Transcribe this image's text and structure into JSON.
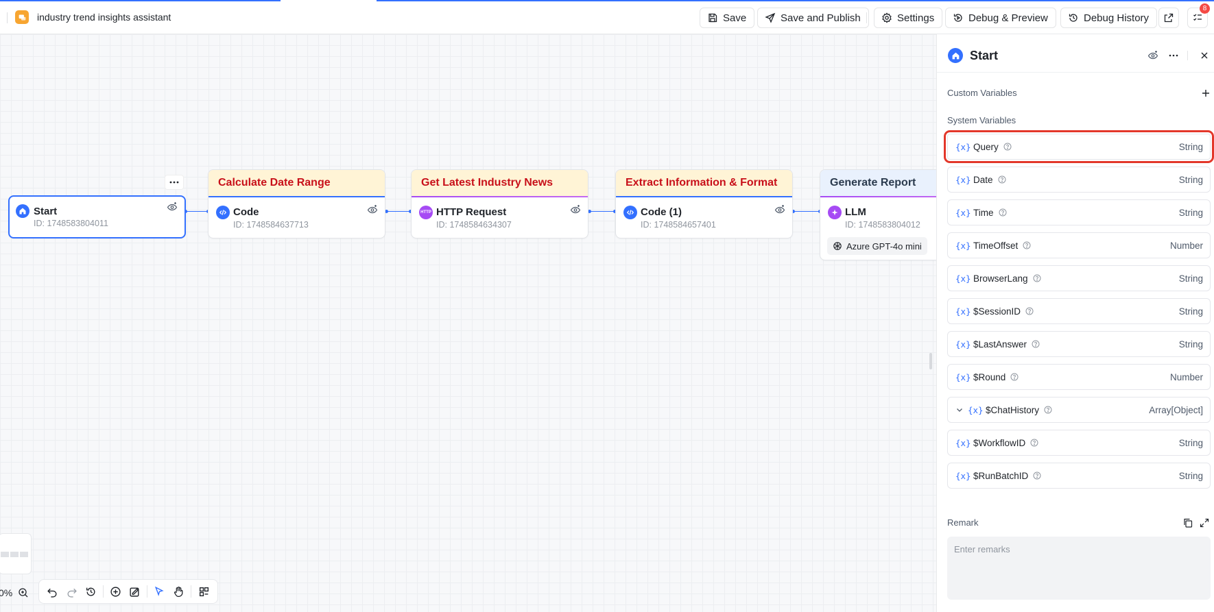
{
  "app": {
    "title": "industry trend insights assistant",
    "accent": "#3370ff"
  },
  "toolbar": {
    "save": "Save",
    "save_publish": "Save and Publish",
    "settings": "Settings",
    "debug_preview": "Debug & Preview",
    "debug_history": "Debug History",
    "notification_count": "8"
  },
  "canvas": {
    "zoom": "0%",
    "nodes": [
      {
        "name": "Start",
        "id": "ID: 1748583804011"
      },
      {
        "header": "Calculate Date Range",
        "name": "Code",
        "id": "ID: 1748584637713"
      },
      {
        "header": "Get Latest Industry News",
        "name": "HTTP Request",
        "id": "ID: 1748584634307",
        "icon_text": "HTTP"
      },
      {
        "header": "Extract Information & Format",
        "name": "Code (1)",
        "id": "ID: 1748584657401"
      },
      {
        "header": "Generate Report",
        "name": "LLM",
        "id": "ID: 1748583804012",
        "model": "Azure GPT-4o mini"
      }
    ]
  },
  "panel": {
    "title": "Start",
    "custom_variables_label": "Custom Variables",
    "system_variables_label": "System Variables",
    "variables": [
      {
        "name": "Query",
        "type": "String"
      },
      {
        "name": "Date",
        "type": "String"
      },
      {
        "name": "Time",
        "type": "String"
      },
      {
        "name": "TimeOffset",
        "type": "Number"
      },
      {
        "name": "BrowserLang",
        "type": "String"
      },
      {
        "name": "$SessionID",
        "type": "String"
      },
      {
        "name": "$LastAnswer",
        "type": "String"
      },
      {
        "name": "$Round",
        "type": "Number"
      },
      {
        "name": "$ChatHistory",
        "type": "Array[Object]"
      },
      {
        "name": "$WorkflowID",
        "type": "String"
      },
      {
        "name": "$RunBatchID",
        "type": "String"
      }
    ],
    "var_brace": "{x}",
    "remark_label": "Remark",
    "remark_placeholder": "Enter remarks"
  }
}
